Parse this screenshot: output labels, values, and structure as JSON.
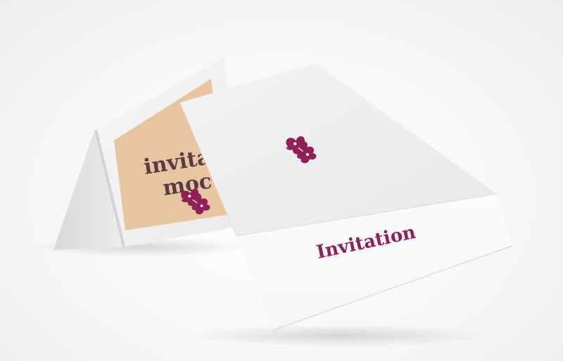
{
  "scene": {
    "background_color": "#f4f4f4",
    "paper_color": "#f2f2f2",
    "panel_color": "#e6c5a0",
    "accent_color": "#8f2158",
    "text_dark_color": "#5a3a44"
  },
  "back_card": {
    "line1": "invitation",
    "line2": "mockup",
    "motif": "floral-motif-icon"
  },
  "front_card": {
    "motif": "floral-motif-icon",
    "title": "Invitation"
  }
}
